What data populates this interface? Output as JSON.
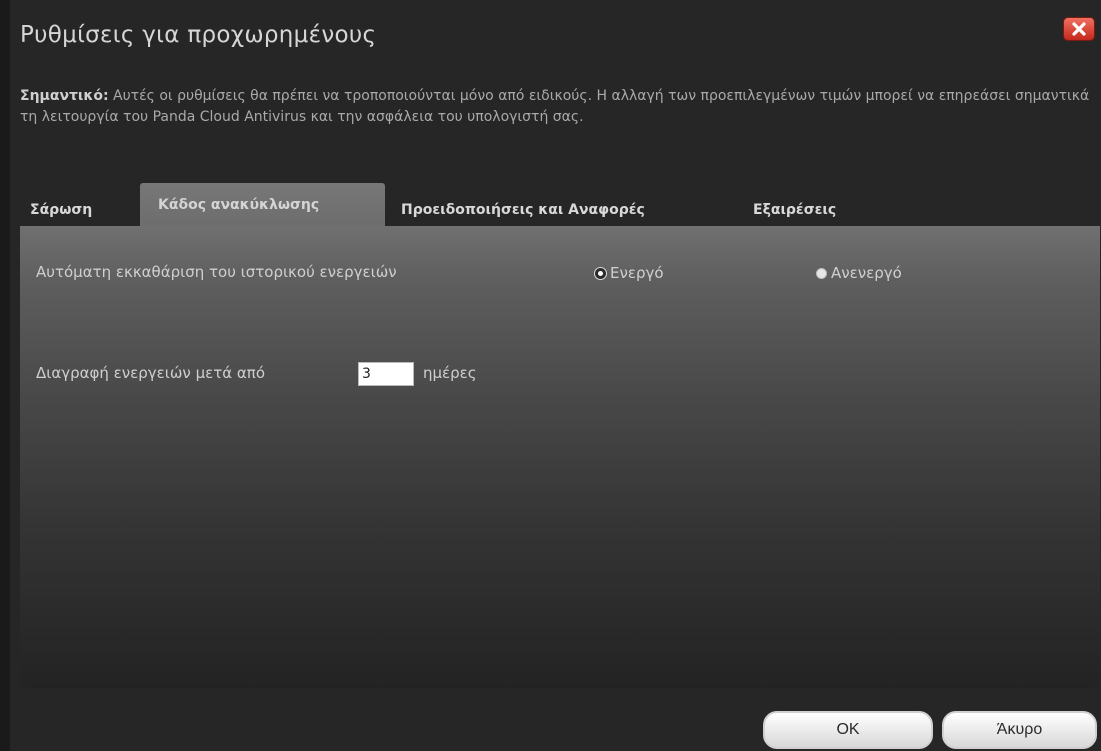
{
  "dialog": {
    "title": "Ρυθμίσεις για προχωρημένους",
    "close_icon": "close-icon"
  },
  "notice": {
    "bold": "Σημαντικό:",
    "text": " Αυτές οι ρυθμίσεις θα πρέπει να τροποποιούνται μόνο από ειδικούς. Η αλλαγή των προεπιλεγμένων τιμών μπορεί να επηρεάσει σημαντικά τη λειτουργία του Panda Cloud Antivirus και την ασφάλεια του υπολογιστή σας."
  },
  "tabs": [
    {
      "label": "Σάρωση",
      "active": false
    },
    {
      "label": "Κάδος ανακύκλωσης",
      "active": true
    },
    {
      "label": "Προειδοποιήσεις και Αναφορές",
      "active": false
    },
    {
      "label": "Εξαιρέσεις",
      "active": false
    }
  ],
  "settings": {
    "auto_clear_label": "Αυτόματη εκκαθάριση του ιστορικού ενεργειών",
    "enabled_label": "Ενεργό",
    "disabled_label": "Ανενεργό",
    "selected": "enabled",
    "delete_after_label": "Διαγραφή ενεργειών μετά από",
    "delete_after_value": "3",
    "days_label": "ημέρες"
  },
  "footer": {
    "ok_label": "OK",
    "cancel_label": "Άκυρο"
  },
  "colors": {
    "close_button": "#d9362a",
    "panel_top": "#707070",
    "panel_bottom": "#232323"
  }
}
